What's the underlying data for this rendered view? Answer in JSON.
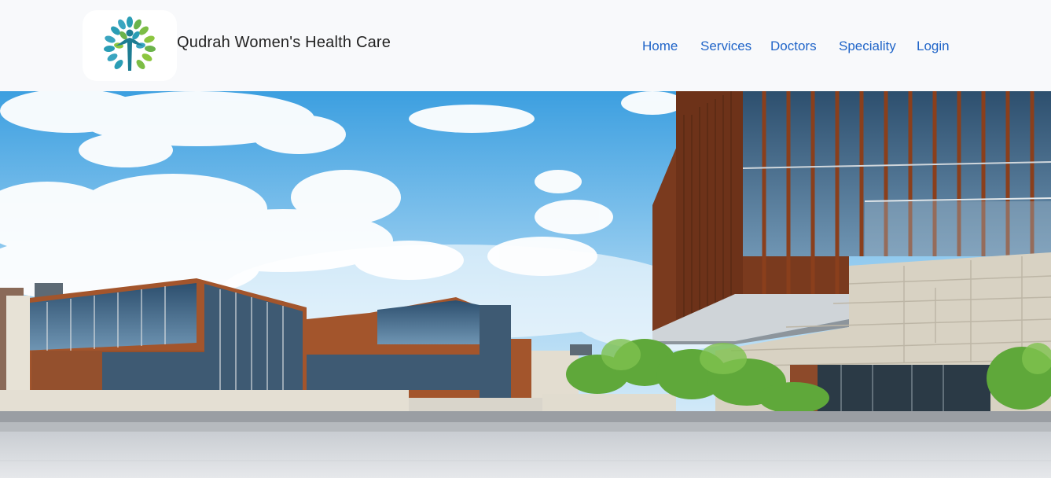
{
  "brand": {
    "name": "Qudrah Women's Health Care",
    "logo_icon": "tree-person-logo-icon"
  },
  "nav": {
    "items": [
      {
        "label": "Home"
      },
      {
        "label": "Services"
      },
      {
        "label": "Doctors"
      },
      {
        "label": "Speciality"
      },
      {
        "label": "Login"
      }
    ],
    "link_color": "#1f64c8"
  },
  "hero": {
    "image": "modern-medical-campus-buildings-under-blue-sky"
  }
}
